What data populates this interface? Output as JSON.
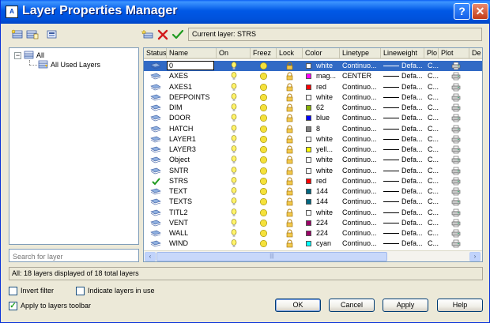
{
  "window": {
    "title": "Layer Properties Manager",
    "app_icon": "autocad-icon",
    "help_glyph": "?",
    "close_glyph": "✕"
  },
  "toolbar": {
    "current_layer_label": "Current layer: STRS",
    "new_layer_icon": "new-layer-icon",
    "delete_icon": "delete-x-icon",
    "set_current_icon": "set-current-check-icon"
  },
  "tree": {
    "root_label": "All",
    "child_label": "All Used Layers",
    "expander": "−"
  },
  "search": {
    "placeholder": "Search for layer"
  },
  "columns": [
    "Status",
    "Name",
    "On",
    "Freez",
    "Lock",
    "Color",
    "Linetype",
    "Lineweight",
    "Plo",
    "Plot",
    "De"
  ],
  "layers": [
    {
      "name": "0",
      "color_name": "white",
      "color_hex": "#ffffff",
      "linetype": "Continuo...",
      "lineweight": "Defa...",
      "plot_style": "C...",
      "status": "layer",
      "selected": true
    },
    {
      "name": "AXES",
      "color_name": "mag...",
      "color_hex": "#ff00ff",
      "linetype": "CENTER",
      "lineweight": "Defa...",
      "plot_style": "C...",
      "status": "layer",
      "selected": false
    },
    {
      "name": "AXES1",
      "color_name": "red",
      "color_hex": "#ff0000",
      "linetype": "Continuo...",
      "lineweight": "Defa...",
      "plot_style": "C...",
      "status": "layer",
      "selected": false
    },
    {
      "name": "DEFPOINTS",
      "color_name": "white",
      "color_hex": "#ffffff",
      "linetype": "Continuo...",
      "lineweight": "Defa...",
      "plot_style": "C...",
      "status": "layer",
      "selected": false
    },
    {
      "name": "DIM",
      "color_name": "62",
      "color_hex": "#88b000",
      "linetype": "Continuo...",
      "lineweight": "Defa...",
      "plot_style": "C...",
      "status": "layer",
      "selected": false
    },
    {
      "name": "DOOR",
      "color_name": "blue",
      "color_hex": "#0000ff",
      "linetype": "Continuo...",
      "lineweight": "Defa...",
      "plot_style": "C...",
      "status": "layer",
      "selected": false
    },
    {
      "name": "HATCH",
      "color_name": "8",
      "color_hex": "#808080",
      "linetype": "Continuo...",
      "lineweight": "Defa...",
      "plot_style": "C...",
      "status": "layer",
      "selected": false
    },
    {
      "name": "LAYER1",
      "color_name": "white",
      "color_hex": "#ffffff",
      "linetype": "Continuo...",
      "lineweight": "Defa...",
      "plot_style": "C...",
      "status": "layer",
      "selected": false
    },
    {
      "name": "LAYER3",
      "color_name": "yell...",
      "color_hex": "#ffff00",
      "linetype": "Continuo...",
      "lineweight": "Defa...",
      "plot_style": "C...",
      "status": "layer",
      "selected": false
    },
    {
      "name": "Object",
      "color_name": "white",
      "color_hex": "#ffffff",
      "linetype": "Continuo...",
      "lineweight": "Defa...",
      "plot_style": "C...",
      "status": "layer",
      "selected": false
    },
    {
      "name": "SNTR",
      "color_name": "white",
      "color_hex": "#ffffff",
      "linetype": "Continuo...",
      "lineweight": "Defa...",
      "plot_style": "C...",
      "status": "layer",
      "selected": false
    },
    {
      "name": "STRS",
      "color_name": "red",
      "color_hex": "#ff0000",
      "linetype": "Continuo...",
      "lineweight": "Defa...",
      "plot_style": "C...",
      "status": "current",
      "selected": false
    },
    {
      "name": "TEXT",
      "color_name": "144",
      "color_hex": "#006680",
      "linetype": "Continuo...",
      "lineweight": "Defa...",
      "plot_style": "C...",
      "status": "layer",
      "selected": false
    },
    {
      "name": "TEXTS",
      "color_name": "144",
      "color_hex": "#006680",
      "linetype": "Continuo...",
      "lineweight": "Defa...",
      "plot_style": "C...",
      "status": "layer",
      "selected": false
    },
    {
      "name": "TITL2",
      "color_name": "white",
      "color_hex": "#ffffff",
      "linetype": "Continuo...",
      "lineweight": "Defa...",
      "plot_style": "C...",
      "status": "layer",
      "selected": false
    },
    {
      "name": "VENT",
      "color_name": "224",
      "color_hex": "#990066",
      "linetype": "Continuo...",
      "lineweight": "Defa...",
      "plot_style": "C...",
      "status": "layer",
      "selected": false
    },
    {
      "name": "WALL",
      "color_name": "224",
      "color_hex": "#990066",
      "linetype": "Continuo...",
      "lineweight": "Defa...",
      "plot_style": "C...",
      "status": "layer",
      "selected": false
    },
    {
      "name": "WIND",
      "color_name": "cyan",
      "color_hex": "#00ffff",
      "linetype": "Continuo...",
      "lineweight": "Defa...",
      "plot_style": "C...",
      "status": "layer",
      "selected": false
    }
  ],
  "scrollbar": {
    "left_arrow": "‹",
    "right_arrow": "›",
    "grip": "|||"
  },
  "status_text": "All: 18 layers displayed of 18 total layers",
  "options": {
    "invert_filter": {
      "label": "Invert filter",
      "checked": false
    },
    "indicate_layers": {
      "label": "Indicate layers in use",
      "checked": false
    },
    "apply_toolbar": {
      "label": "Apply to layers toolbar",
      "checked": true
    }
  },
  "buttons": {
    "ok": "OK",
    "cancel": "Cancel",
    "apply": "Apply",
    "help": "Help"
  }
}
